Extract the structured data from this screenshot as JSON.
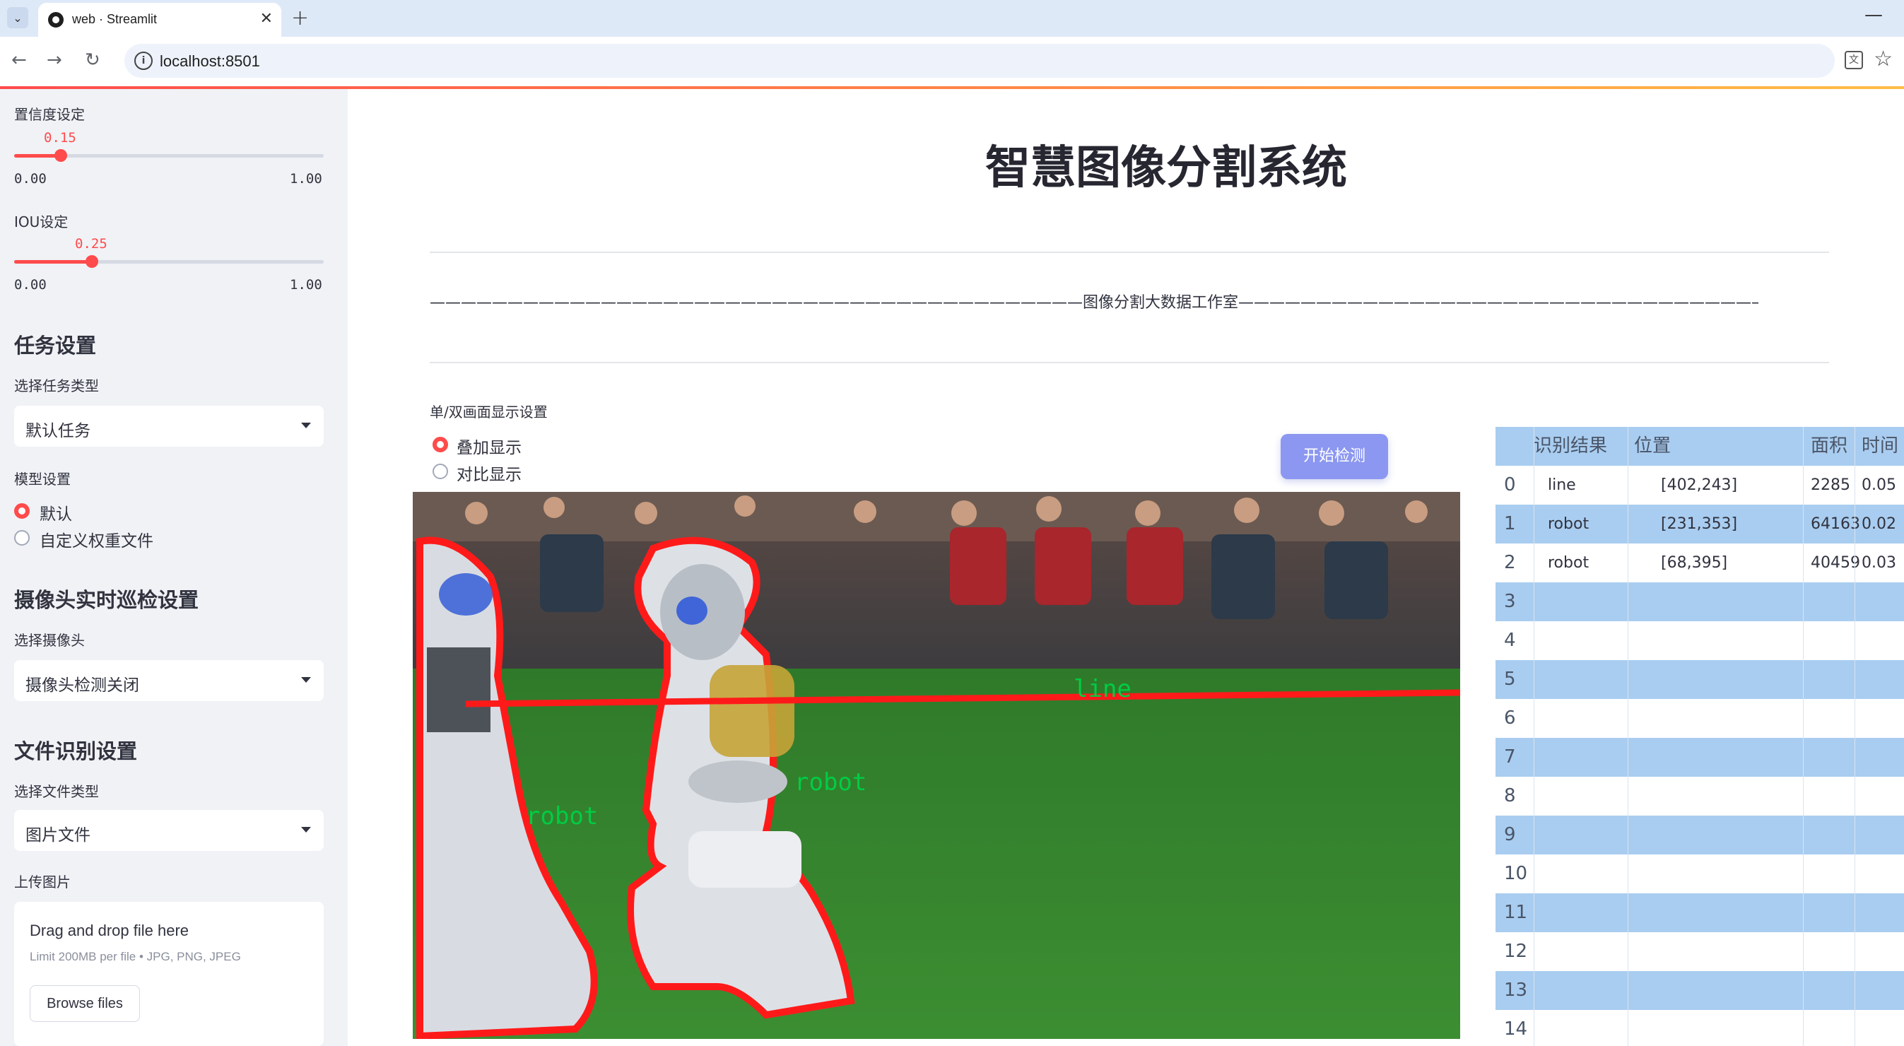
{
  "browser": {
    "tab_title": "web · Streamlit",
    "url": "localhost:8501"
  },
  "sidebar": {
    "confidence": {
      "label": "置信度设定",
      "value": "0.15",
      "min": "0.00",
      "max": "1.00",
      "level": 0.15
    },
    "iou": {
      "label": "IOU设定",
      "value": "0.25",
      "min": "0.00",
      "max": "1.00",
      "level": 0.25
    },
    "task": {
      "heading": "任务设置",
      "label": "选择任务类型",
      "selected": "默认任务"
    },
    "model": {
      "label": "模型设置",
      "options": [
        "默认",
        "自定义权重文件"
      ],
      "selected_index": 0
    },
    "camera": {
      "heading": "摄像头实时巡检设置",
      "label": "选择摄像头",
      "selected": "摄像头检测关闭"
    },
    "file": {
      "heading": "文件识别设置",
      "type_label": "选择文件类型",
      "type_selected": "图片文件",
      "upload_label": "上传图片",
      "drop_text": "Drag and drop file here",
      "limit_text": "Limit 200MB per file • JPG, PNG, JPEG",
      "browse_label": "Browse files"
    }
  },
  "main": {
    "title": "智慧图像分割系统",
    "subtitle": "——————————————————————————————————————————图像分割大数据工作室——————————————————————————————————————————",
    "display": {
      "label": "单/双画面显示设置",
      "options": [
        "叠加显示",
        "对比显示"
      ],
      "selected_index": 0
    },
    "start_button": "开始检测",
    "image": {
      "detections": [
        {
          "label": "line",
          "color": "#00cc44"
        },
        {
          "label": "robot",
          "color": "#00cc44"
        },
        {
          "label": "robot",
          "color": "#00cc44"
        }
      ],
      "mask_color": "#ff1a1a"
    }
  },
  "results": {
    "columns": [
      "识别结果",
      "位置",
      "面积",
      "时间"
    ],
    "rows": [
      {
        "idx": "0",
        "label": "line",
        "pos": "[402,243]",
        "area": "2285",
        "time": "0.05"
      },
      {
        "idx": "1",
        "label": "robot",
        "pos": "[231,353]",
        "area": "64163",
        "time": "0.02"
      },
      {
        "idx": "2",
        "label": "robot",
        "pos": "[68,395]",
        "area": "40459",
        "time": "0.03"
      },
      {
        "idx": "3",
        "label": "",
        "pos": "",
        "area": "",
        "time": ""
      },
      {
        "idx": "4",
        "label": "",
        "pos": "",
        "area": "",
        "time": ""
      },
      {
        "idx": "5",
        "label": "",
        "pos": "",
        "area": "",
        "time": ""
      },
      {
        "idx": "6",
        "label": "",
        "pos": "",
        "area": "",
        "time": ""
      },
      {
        "idx": "7",
        "label": "",
        "pos": "",
        "area": "",
        "time": ""
      },
      {
        "idx": "8",
        "label": "",
        "pos": "",
        "area": "",
        "time": ""
      },
      {
        "idx": "9",
        "label": "",
        "pos": "",
        "area": "",
        "time": ""
      },
      {
        "idx": "10",
        "label": "",
        "pos": "",
        "area": "",
        "time": ""
      },
      {
        "idx": "11",
        "label": "",
        "pos": "",
        "area": "",
        "time": ""
      },
      {
        "idx": "12",
        "label": "",
        "pos": "",
        "area": "",
        "time": ""
      },
      {
        "idx": "13",
        "label": "",
        "pos": "",
        "area": "",
        "time": ""
      },
      {
        "idx": "14",
        "label": "",
        "pos": "",
        "area": "",
        "time": ""
      }
    ],
    "header_color": "#a9cdf0",
    "stripe_color": "#a9cdf0"
  }
}
